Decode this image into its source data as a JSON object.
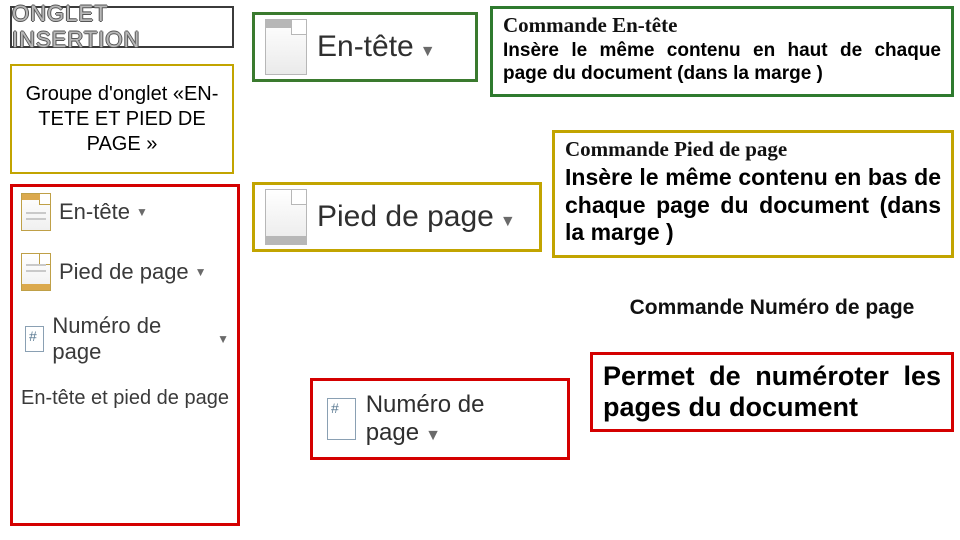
{
  "title": "ONGLET INSERTION",
  "group": "Groupe d'onglet «EN-TETE ET PIED DE PAGE »",
  "ribbon": {
    "items": {
      "header": "En-tête",
      "footer": "Pied de page",
      "pageno": "Numéro de page"
    },
    "footerLabel": "En-tête et pied de page"
  },
  "big": {
    "header": "En-tête",
    "footer": "Pied de page",
    "pageno": "Numéro de page"
  },
  "desc": {
    "header": {
      "title": "Commande En-tête",
      "text": "Insère le même contenu en haut de chaque page du document (dans la marge )"
    },
    "footer": {
      "title": "Commande Pied de page",
      "text": "Insère le même contenu en bas de chaque page du document (dans la marge )"
    },
    "pageno": {
      "title": "Commande Numéro de page",
      "text": "Permet de numéroter les pages du document"
    }
  }
}
